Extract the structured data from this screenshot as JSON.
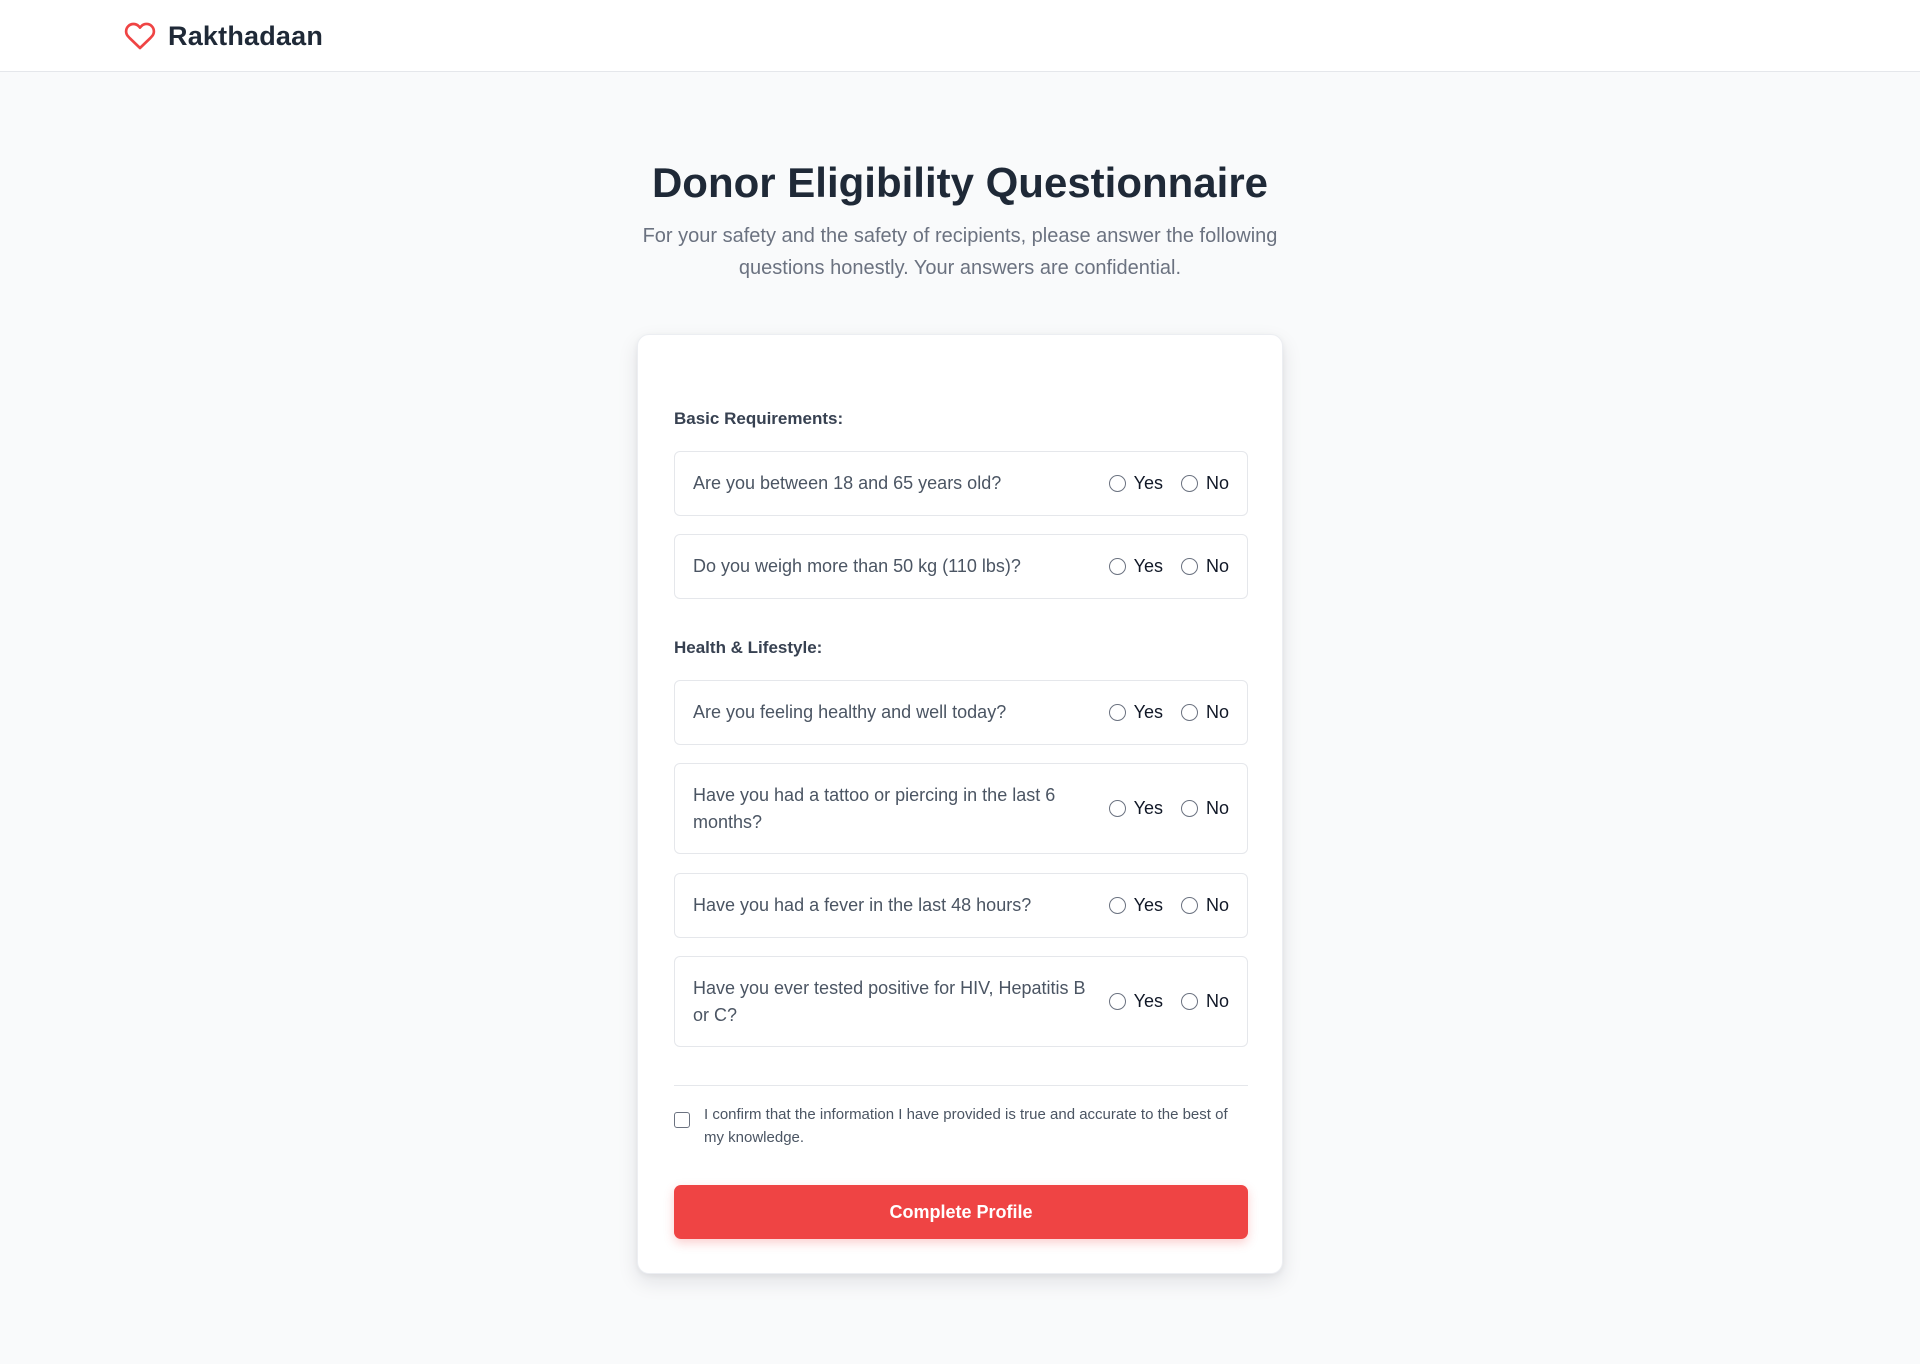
{
  "header": {
    "brand_name": "Rakthadaan",
    "logo_icon": "heart-outline-icon",
    "accent_color": "#ef4444"
  },
  "hero": {
    "title": "Donor Eligibility Questionnaire",
    "subtitle": "For your safety and the safety of recipients, please answer the following questions honestly. Your answers are confidential."
  },
  "form": {
    "sections": [
      {
        "label": "Basic Requirements:",
        "questions": [
          {
            "text": "Are you between 18 and 65 years old?",
            "yes": "Yes",
            "no": "No",
            "selected": null
          },
          {
            "text": "Do you weigh more than 50 kg (110 lbs)?",
            "yes": "Yes",
            "no": "No",
            "selected": null
          }
        ]
      },
      {
        "label": "Health & Lifestyle:",
        "questions": [
          {
            "text": "Are you feeling healthy and well today?",
            "yes": "Yes",
            "no": "No",
            "selected": null
          },
          {
            "text": "Have you had a tattoo or piercing in the last 6 months?",
            "yes": "Yes",
            "no": "No",
            "selected": null
          },
          {
            "text": "Have you had a fever in the last 48 hours?",
            "yes": "Yes",
            "no": "No",
            "selected": null
          },
          {
            "text": "Have you ever tested positive for HIV, Hepatitis B or C?",
            "yes": "Yes",
            "no": "No",
            "selected": null
          }
        ]
      }
    ],
    "confirm_text": "I confirm that the information I have provided is true and accurate to the best of my knowledge.",
    "confirm_checked": false,
    "submit_label": "Complete Profile"
  }
}
